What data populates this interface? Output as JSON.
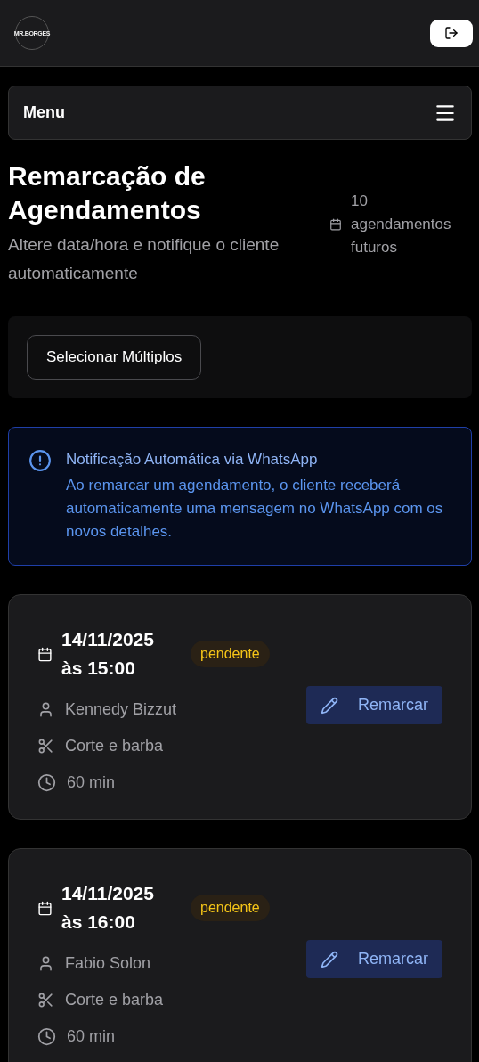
{
  "header": {
    "logo": "MR.BORGES"
  },
  "menu": {
    "label": "Menu"
  },
  "page": {
    "title": "Remarcação de Agendamentos",
    "subtitle": "Altere data/hora e notifique o cliente automaticamente",
    "count": "10 agendamentos futuros"
  },
  "toolbar": {
    "button": "Selecionar Múltiplos"
  },
  "notice": {
    "title": "Notificação Automática via WhatsApp",
    "text": "Ao remarcar um agendamento, o cliente receberá automaticamente uma mensagem no WhatsApp com os novos detalhes."
  },
  "appointments": [
    {
      "date": "14/11/2025",
      "time": "às 15:00",
      "status": "pendente",
      "client": "Kennedy Bizzut",
      "service": "Corte e barba",
      "duration": "60 min",
      "action": "Remarcar"
    },
    {
      "date": "14/11/2025",
      "time": "às 16:00",
      "status": "pendente",
      "client": "Fabio Solon",
      "service": "Corte e barba",
      "duration": "60 min",
      "action": "Remarcar"
    }
  ]
}
